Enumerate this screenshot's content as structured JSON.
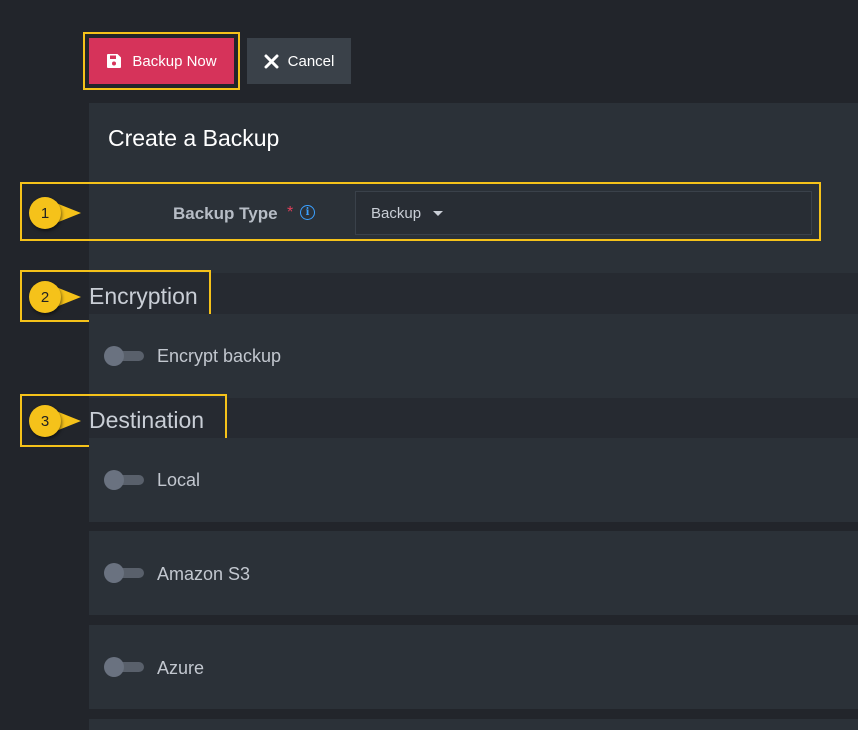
{
  "toolbar": {
    "backup_now_label": "Backup Now",
    "cancel_label": "Cancel"
  },
  "form": {
    "title": "Create a Backup",
    "backup_type": {
      "label": "Backup Type",
      "required_mark": "*",
      "info_glyph": "i",
      "value": "Backup"
    }
  },
  "sections": {
    "encryption": {
      "title": "Encryption",
      "toggles": [
        {
          "label": "Encrypt backup",
          "enabled": false
        }
      ]
    },
    "destination": {
      "title": "Destination",
      "toggles": [
        {
          "label": "Local",
          "enabled": false
        },
        {
          "label": "Amazon S3",
          "enabled": false
        },
        {
          "label": "Azure",
          "enabled": false
        }
      ]
    }
  },
  "callouts": [
    "1",
    "2",
    "3"
  ],
  "icons": {
    "backup_now": "save-icon",
    "cancel": "close-icon",
    "info": "info-icon",
    "dropdown": "chevron-down-icon"
  },
  "colors": {
    "background": "#22252b",
    "panel": "#2b3138",
    "primary": "#d6335a",
    "secondary": "#3a4149",
    "highlight": "#f5c21a",
    "info": "#3ba0ff",
    "required": "#e0405b"
  }
}
